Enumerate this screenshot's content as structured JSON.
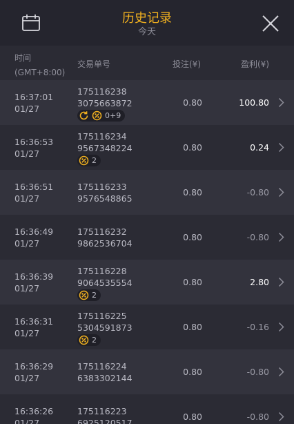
{
  "header": {
    "title": "历史记录",
    "subtitle": "今天"
  },
  "columns": {
    "time_line1": "时间",
    "time_line2": "(GMT+8:00)",
    "order": "交易单号",
    "bet": "投注(¥)",
    "profit": "盈利(¥)"
  },
  "colors": {
    "accent": "#f3b21f",
    "background": "#2b2b34",
    "header_bg": "#25252e",
    "text_muted": "#8e8e99"
  },
  "rows": [
    {
      "time": "16:37:01",
      "date": "01/27",
      "order1": "175116238",
      "order2": "3075663872",
      "bet": "0.80",
      "profit": "100.80",
      "badge": "0+9",
      "icons": [
        "refresh-icon",
        "coin-icon"
      ]
    },
    {
      "time": "16:36:53",
      "date": "01/27",
      "order1": "175116234",
      "order2": "9567348224",
      "bet": "0.80",
      "profit": "0.24",
      "badge": "2",
      "icons": [
        "coin-icon"
      ]
    },
    {
      "time": "16:36:51",
      "date": "01/27",
      "order1": "175116233",
      "order2": "9576548865",
      "bet": "0.80",
      "profit": "-0.80"
    },
    {
      "time": "16:36:49",
      "date": "01/27",
      "order1": "175116232",
      "order2": "9862536704",
      "bet": "0.80",
      "profit": "-0.80"
    },
    {
      "time": "16:36:39",
      "date": "01/27",
      "order1": "175116228",
      "order2": "9064535554",
      "bet": "0.80",
      "profit": "2.80",
      "badge": "2",
      "icons": [
        "coin-icon"
      ]
    },
    {
      "time": "16:36:31",
      "date": "01/27",
      "order1": "175116225",
      "order2": "5304591873",
      "bet": "0.80",
      "profit": "-0.16",
      "badge": "2",
      "icons": [
        "coin-icon"
      ]
    },
    {
      "time": "16:36:29",
      "date": "01/27",
      "order1": "175116224",
      "order2": "6383302144",
      "bet": "0.80",
      "profit": "-0.80"
    },
    {
      "time": "16:36:26",
      "date": "01/27",
      "order1": "175116223",
      "order2": "6925120517",
      "bet": "0.80",
      "profit": "-0.80"
    }
  ]
}
